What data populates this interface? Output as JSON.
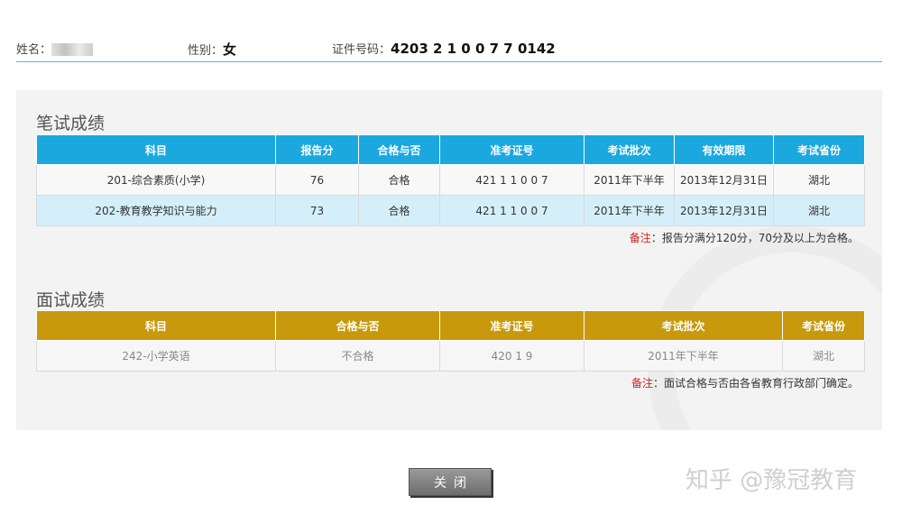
{
  "header": {
    "name_label": "姓名：",
    "name_value": "",
    "gender_label": "性别：",
    "gender_value": "女",
    "id_label": "证件号码：",
    "id_value": "4203  2  1  0  0  7  7  0142"
  },
  "written": {
    "title": "笔试成绩",
    "columns": [
      "科目",
      "报告分",
      "合格与否",
      "准考证号",
      "考试批次",
      "有效期限",
      "考试省份"
    ],
    "rows": [
      [
        "201-综合素质(小学)",
        "76",
        "合格",
        "421    1  1  0  0  7",
        "2011年下半年",
        "2013年12月31日",
        "湖北"
      ],
      [
        "202-教育教学知识与能力",
        "73",
        "合格",
        "421    1  1  0  0  7",
        "2011年下半年",
        "2013年12月31日",
        "湖北"
      ]
    ],
    "note_label": "备注",
    "note_text": "：报告分满分120分，70分及以上为合格。"
  },
  "interview": {
    "title": "面试成绩",
    "columns": [
      "科目",
      "合格与否",
      "准考证号",
      "考试批次",
      "考试省份"
    ],
    "rows": [
      [
        "242-小学英语",
        "不合格",
        "420      1  9",
        "2011年下半年",
        "湖北"
      ]
    ],
    "note_label": "备注",
    "note_text": "：面试合格与否由各省教育行政部门确定。"
  },
  "close_label": "关闭",
  "brand": "知乎 @豫冠教育",
  "colors": {
    "written_header": "#1aa8df",
    "interview_header": "#c8990d",
    "note_red": "#d02020"
  }
}
